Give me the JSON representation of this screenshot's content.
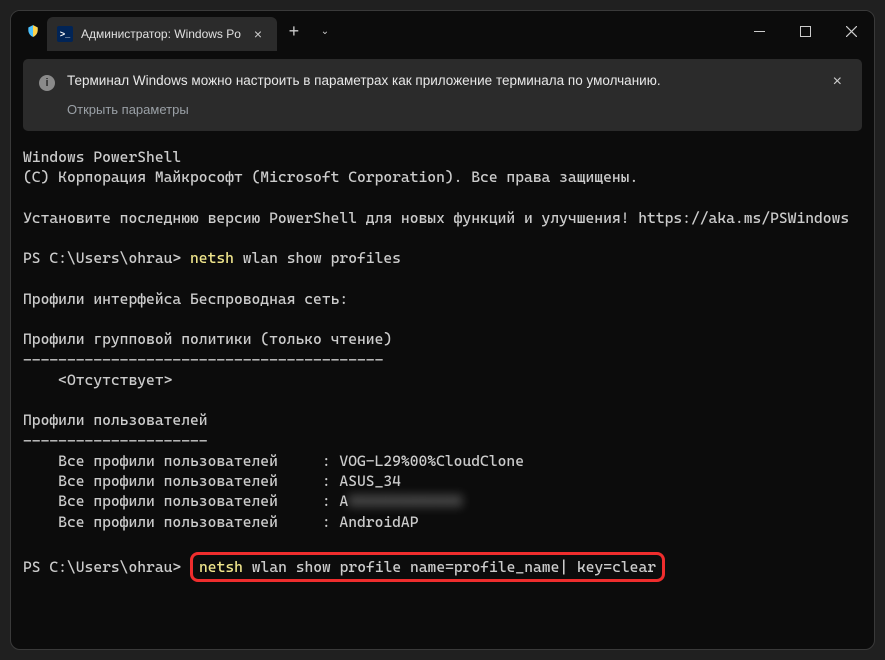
{
  "titlebar": {
    "tab_title": "Администратор: Windows Po",
    "tab_close": "×",
    "new_tab": "+",
    "dropdown": "⌄"
  },
  "info_bar": {
    "text": "Терминал Windows можно настроить в параметрах как приложение терминала по умолчанию.",
    "link": "Открыть параметры",
    "close": "×"
  },
  "terminal": {
    "line1": "Windows PowerShell",
    "line2": "(C) Корпорация Майкрософт (Microsoft Corporation). Все права защищены.",
    "line3": "Установите последнюю версию PowerShell для новых функций и улучшения! https://aka.ms/PSWindows",
    "prompt1_path": "PS C:\\Users\\ohrau> ",
    "cmd1_yellow": "netsh",
    "cmd1_rest": " wlan show profiles",
    "section1": "Профили интерфейса Беспроводная сеть:",
    "section2": "Профили групповой политики (только чтение)",
    "dashes2": "-----------------------------------------",
    "absent": "    <Отсутствует>",
    "section3": "Профили пользователей",
    "dashes3": "---------------------",
    "profile_label": "    Все профили пользователей     : ",
    "p1": "VOG-L29%00%CloudClone",
    "p2": "ASUS_34",
    "p3": "A",
    "p3_blur": "XXXXXXXXXXXXX",
    "p4": "AndroidAP",
    "prompt2_path": "PS C:\\Users\\ohrau> ",
    "cmd2_yellow": "netsh",
    "cmd2_rest": " wlan show profile name=profile_name| key=clear"
  }
}
